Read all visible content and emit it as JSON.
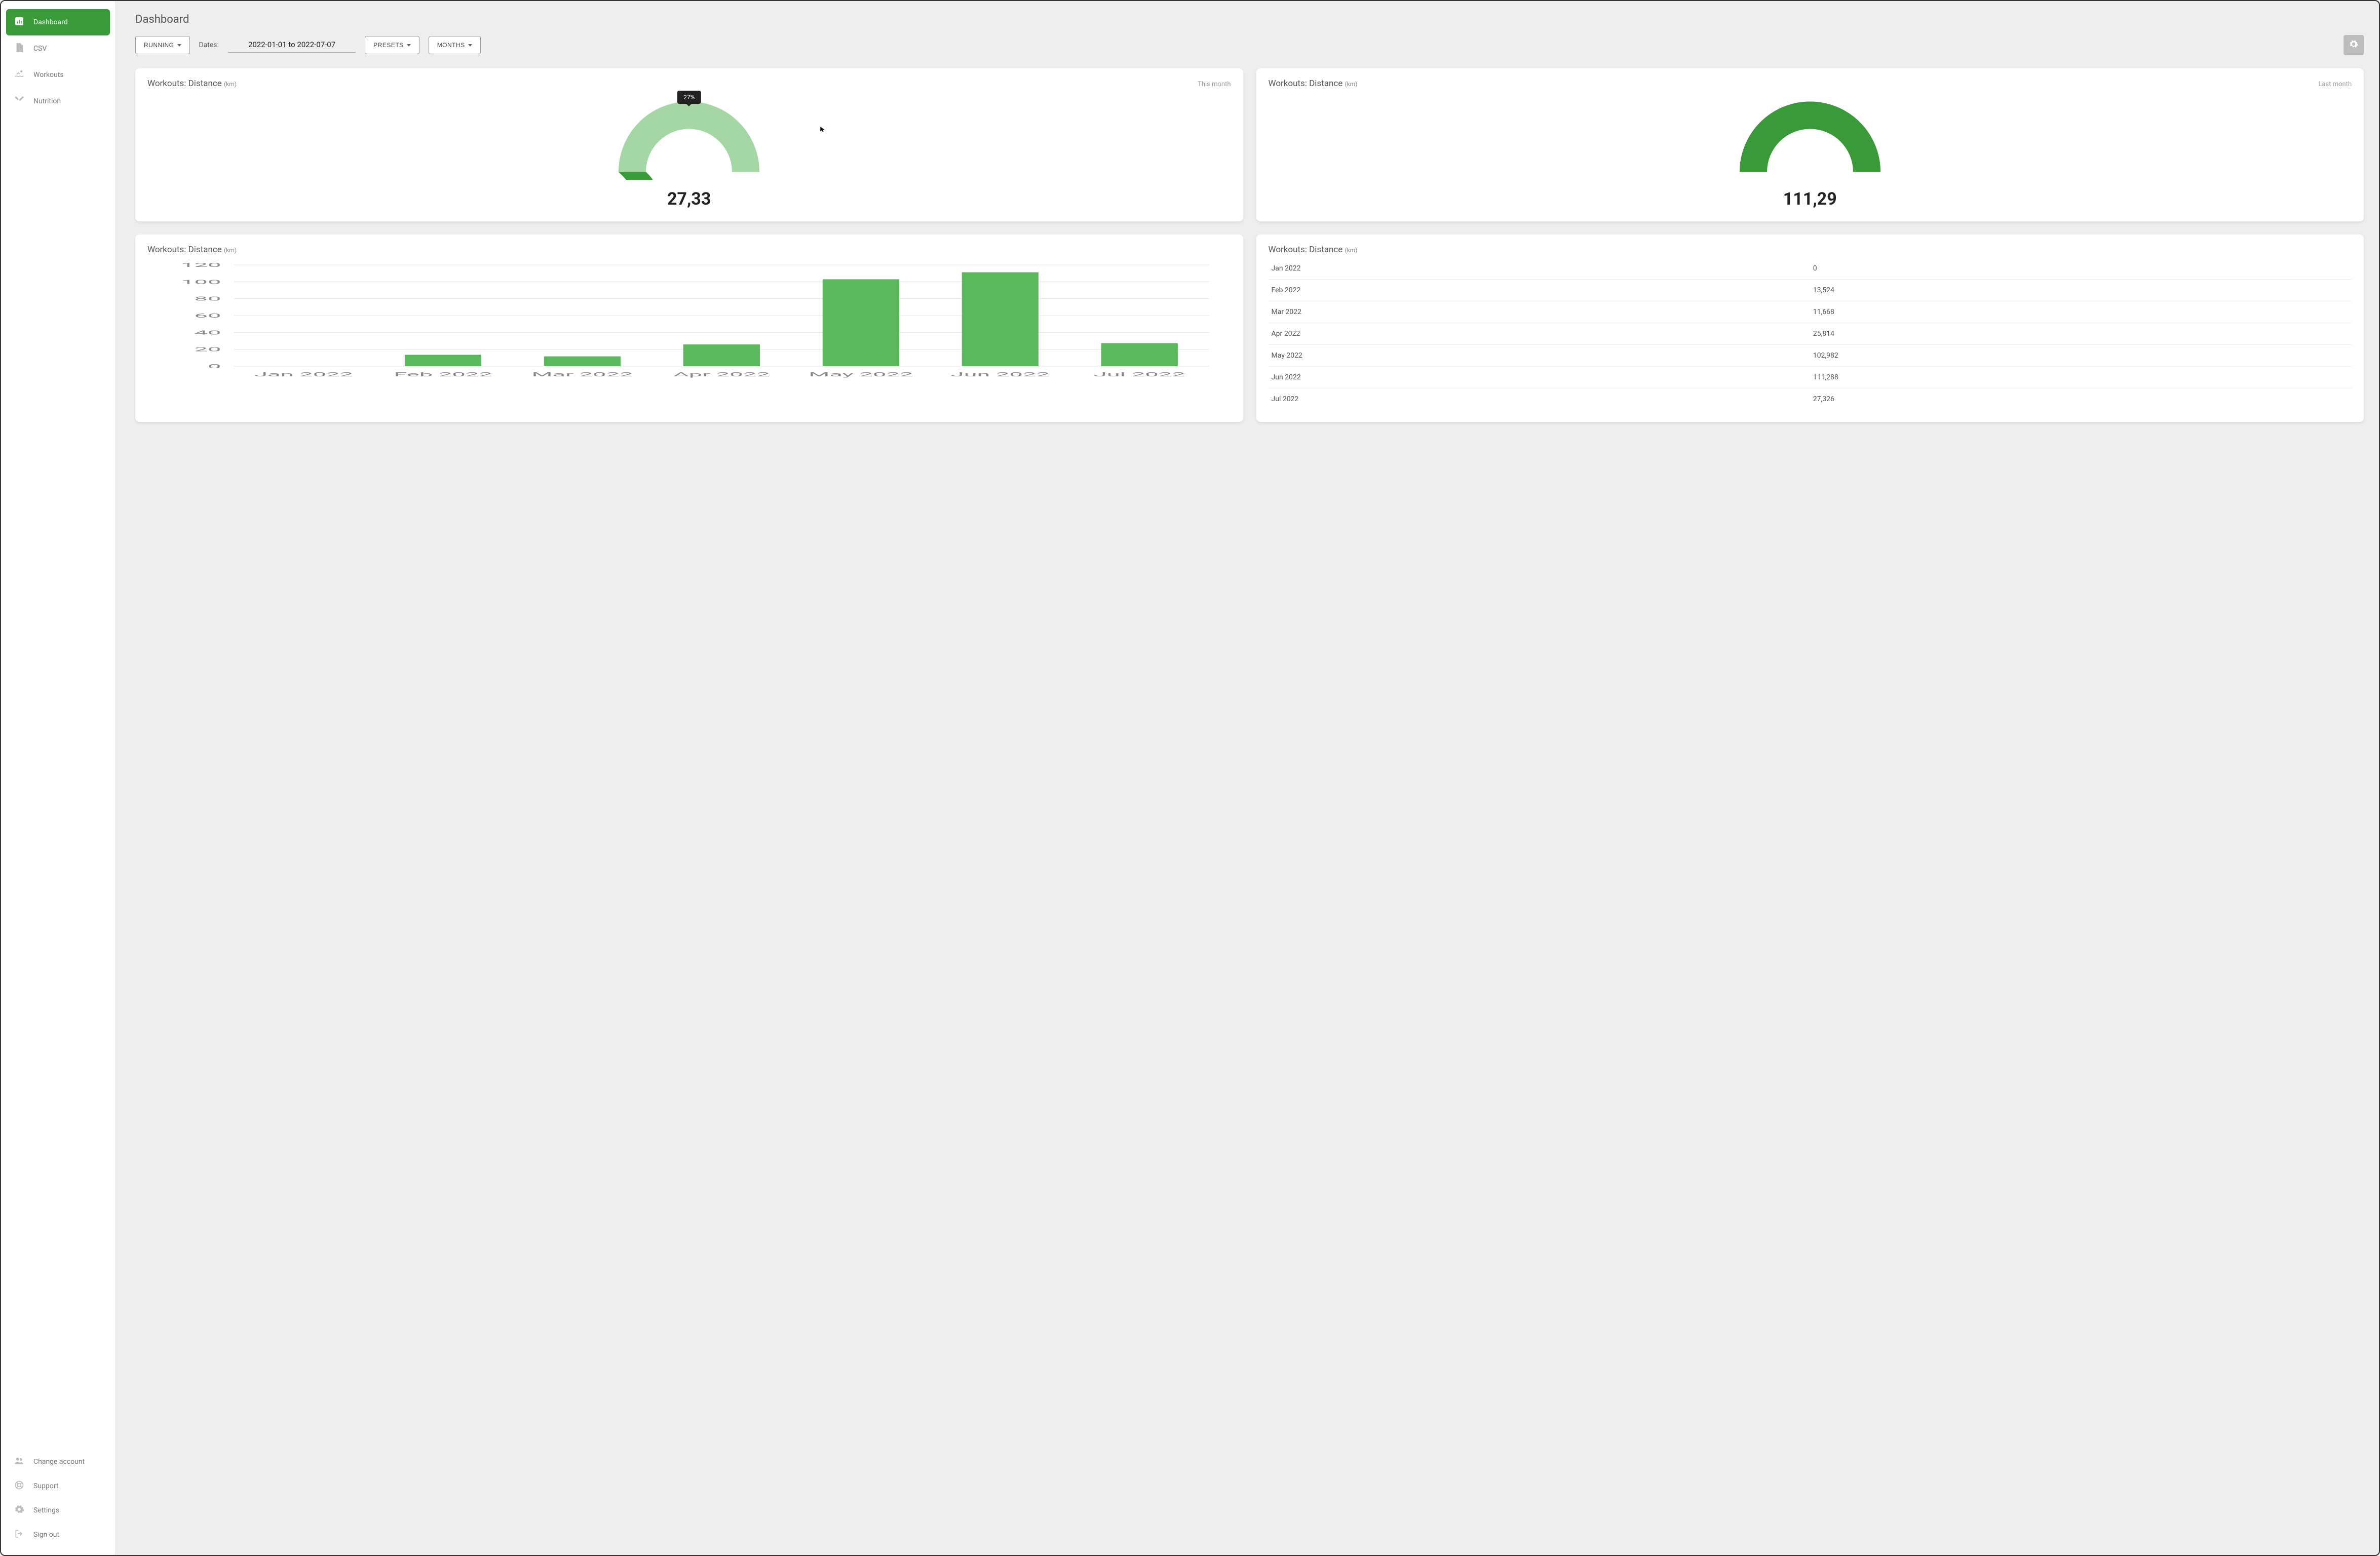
{
  "sidebar": {
    "top": [
      {
        "label": "Dashboard",
        "icon": "bar-chart-icon",
        "active": true
      },
      {
        "label": "CSV",
        "icon": "file-icon",
        "active": false
      },
      {
        "label": "Workouts",
        "icon": "swimmer-icon",
        "active": false
      },
      {
        "label": "Nutrition",
        "icon": "utensils-icon",
        "active": false
      }
    ],
    "bottom": [
      {
        "label": "Change account",
        "icon": "people-icon"
      },
      {
        "label": "Support",
        "icon": "life-ring-icon"
      },
      {
        "label": "Settings",
        "icon": "gear-icon"
      },
      {
        "label": "Sign out",
        "icon": "signout-icon"
      }
    ]
  },
  "page": {
    "title": "Dashboard"
  },
  "toolbar": {
    "activity_label": "RUNNING",
    "dates_label": "Dates:",
    "dates_value": "2022-01-01 to 2022-07-07",
    "presets_label": "PRESETS",
    "months_label": "MONTHS"
  },
  "gauges": {
    "this_month": {
      "title": "Workouts: Distance",
      "unit": "(km)",
      "badge": "This month",
      "value_label": "27,33",
      "percent": 27,
      "tooltip": "27%"
    },
    "last_month": {
      "title": "Workouts: Distance",
      "unit": "(km)",
      "badge": "Last month",
      "value_label": "111,29",
      "percent": 100
    }
  },
  "chart_data": {
    "type": "bar",
    "title": "Workouts: Distance",
    "unit": "(km)",
    "categories": [
      "Jan 2022",
      "Feb 2022",
      "Mar 2022",
      "Apr 2022",
      "May 2022",
      "Jun 2022",
      "Jul 2022"
    ],
    "values": [
      0,
      13.524,
      11.668,
      25.814,
      102.982,
      111.288,
      27.326
    ],
    "ylim": [
      0,
      120
    ],
    "yticks": [
      0,
      20,
      40,
      60,
      80,
      100,
      120
    ],
    "xlabel": "",
    "ylabel": ""
  },
  "table": {
    "title": "Workouts: Distance",
    "unit": "(km)",
    "rows": [
      {
        "label": "Jan 2022",
        "value": "0"
      },
      {
        "label": "Feb 2022",
        "value": "13,524"
      },
      {
        "label": "Mar 2022",
        "value": "11,668"
      },
      {
        "label": "Apr 2022",
        "value": "25,814"
      },
      {
        "label": "May 2022",
        "value": "102,982"
      },
      {
        "label": "Jun 2022",
        "value": "111,288"
      },
      {
        "label": "Jul 2022",
        "value": "27,326"
      }
    ]
  },
  "colors": {
    "brand": "#3a9a3a",
    "bar": "#5cb85c",
    "gauge_fg": "#3a9a3a",
    "gauge_bg": "#a5d6a5"
  }
}
